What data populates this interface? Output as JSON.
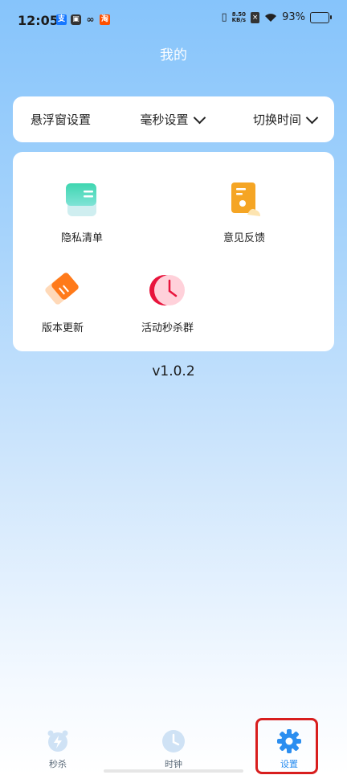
{
  "status_bar": {
    "time": "12:05",
    "net_speed_value": "8.50",
    "net_speed_unit": "KB/s",
    "battery_percent": "93%",
    "battery_level": 0.93,
    "notif_icons": [
      "alipay-icon",
      "wallet-icon",
      "link-icon",
      "taobao-icon"
    ]
  },
  "header": {
    "title": "我的"
  },
  "settings": {
    "float_window": "悬浮窗设置",
    "millisecond": "毫秒设置",
    "switch_time": "切换时间"
  },
  "menu": {
    "items": [
      {
        "label": "隐私清单",
        "icon": "privacy-list-icon"
      },
      {
        "label": "意见反馈",
        "icon": "feedback-icon"
      },
      {
        "label": "版本更新",
        "icon": "update-icon"
      },
      {
        "label": "活动秒杀群",
        "icon": "group-icon"
      }
    ]
  },
  "version": "v1.0.2",
  "nav": {
    "items": [
      {
        "label": "秒杀",
        "icon": "alarm-bolt-icon",
        "active": false
      },
      {
        "label": "时钟",
        "icon": "clock-icon",
        "active": false
      },
      {
        "label": "设置",
        "icon": "gear-icon",
        "active": true
      }
    ]
  },
  "colors": {
    "accent": "#2b8ef0",
    "highlight": "#d81e1e",
    "background_top": "#86c4fb"
  }
}
